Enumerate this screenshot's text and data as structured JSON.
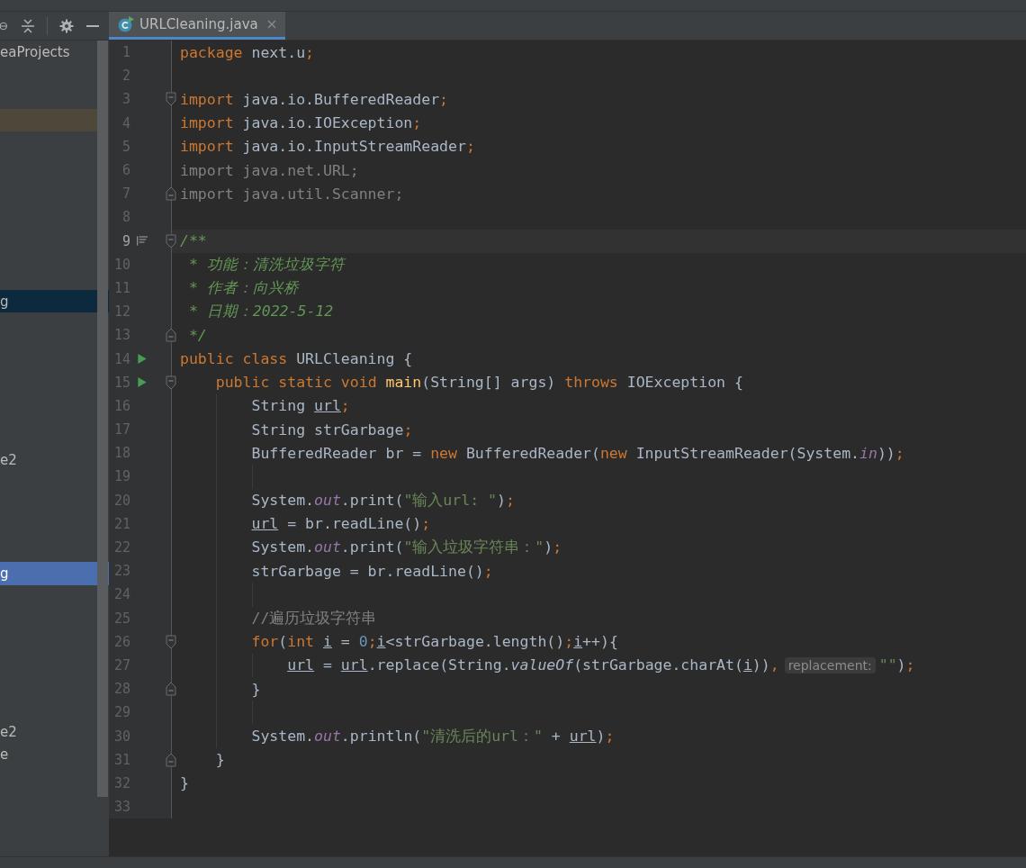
{
  "sidebar": {
    "rows": [
      {
        "label": "eaProjects",
        "selected": false
      },
      {
        "selected": false
      },
      {
        "selected": false
      },
      {
        "selected": false,
        "hovered": true
      },
      {
        "selected": false
      },
      {
        "selected": false
      },
      {
        "selected": false
      },
      {
        "selected": false
      },
      {
        "selected": false
      },
      {
        "selected": false
      },
      {
        "selected": false
      },
      {
        "label": "g",
        "selected": true,
        "focused": false
      },
      {
        "selected": false
      },
      {
        "selected": false
      },
      {
        "selected": false
      },
      {
        "selected": false
      },
      {
        "selected": false
      },
      {
        "selected": false
      },
      {
        "label": "e2",
        "selected": false
      },
      {
        "selected": false
      },
      {
        "selected": false
      },
      {
        "selected": false
      },
      {
        "selected": false
      },
      {
        "label": "g",
        "selected": true,
        "focused": true
      },
      {
        "selected": false
      },
      {
        "selected": false
      },
      {
        "selected": false
      },
      {
        "selected": false
      },
      {
        "selected": false
      },
      {
        "selected": false
      },
      {
        "label": "e2",
        "selected": false
      },
      {
        "label": "e",
        "selected": false
      }
    ]
  },
  "tabs": [
    {
      "label": "URLCleaning.java",
      "selected": true
    }
  ],
  "editor": {
    "lines": [
      {
        "n": "1",
        "tokens": [
          {
            "text": "package ",
            "kind": "kw"
          },
          {
            "text": "next.u",
            "kind": "plain"
          },
          {
            "text": ";",
            "kind": "semi"
          }
        ]
      },
      {
        "n": "2"
      },
      {
        "n": "3",
        "fold_start": true,
        "tokens": [
          {
            "text": "import ",
            "kind": "kw"
          },
          {
            "text": "java.io.BufferedReader",
            "kind": "plain"
          },
          {
            "text": ";",
            "kind": "semi"
          }
        ]
      },
      {
        "n": "4",
        "tokens": [
          {
            "text": "import ",
            "kind": "kw"
          },
          {
            "text": "java.io.IOException",
            "kind": "plain"
          },
          {
            "text": ";",
            "kind": "semi"
          }
        ]
      },
      {
        "n": "5",
        "tokens": [
          {
            "text": "import ",
            "kind": "kw"
          },
          {
            "text": "java.io.InputStreamReader",
            "kind": "plain"
          },
          {
            "text": ";",
            "kind": "semi"
          }
        ]
      },
      {
        "n": "6",
        "tokens": [
          {
            "text": "import java.net.URL;",
            "kind": "unused"
          }
        ]
      },
      {
        "n": "7",
        "fold_end": true,
        "tokens": [
          {
            "text": "import java.util.Scanner;",
            "kind": "unused"
          }
        ]
      },
      {
        "n": "8"
      },
      {
        "n": "9",
        "current": true,
        "doc_marker": true,
        "fold_start": true,
        "tokens": [
          {
            "text": "/**",
            "kind": "doc"
          }
        ]
      },
      {
        "n": "10",
        "tokens": [
          {
            "text": " * 功能：清洗垃圾字符",
            "kind": "doc"
          }
        ]
      },
      {
        "n": "11",
        "tokens": [
          {
            "text": " * 作者：向兴桥",
            "kind": "doc"
          }
        ]
      },
      {
        "n": "12",
        "tokens": [
          {
            "text": " * 日期：2022-5-12",
            "kind": "doc"
          }
        ]
      },
      {
        "n": "13",
        "fold_end": true,
        "tokens": [
          {
            "text": " */",
            "kind": "doc"
          }
        ]
      },
      {
        "n": "14",
        "run_marker": true,
        "tokens": [
          {
            "text": "public class ",
            "kind": "kw"
          },
          {
            "text": "URLCleaning {",
            "kind": "plain"
          }
        ]
      },
      {
        "n": "15",
        "run_marker": true,
        "fold_start": true,
        "tokens": [
          {
            "text": "    public static void ",
            "kind": "kw"
          },
          {
            "text": "main",
            "kind": "fn"
          },
          {
            "text": "(String[] args) ",
            "kind": "plain"
          },
          {
            "text": "throws ",
            "kind": "kw"
          },
          {
            "text": "IOException {",
            "kind": "plain"
          }
        ]
      },
      {
        "n": "16",
        "tokens": [
          {
            "text": "        String ",
            "kind": "plain"
          },
          {
            "text": "url",
            "kind": "var"
          },
          {
            "text": ";",
            "kind": "semi"
          }
        ]
      },
      {
        "n": "17",
        "tokens": [
          {
            "text": "        String strGarbage",
            "kind": "plain"
          },
          {
            "text": ";",
            "kind": "semi"
          }
        ]
      },
      {
        "n": "18",
        "tokens": [
          {
            "text": "        BufferedReader br = ",
            "kind": "plain"
          },
          {
            "text": "new ",
            "kind": "kw"
          },
          {
            "text": "BufferedReader(",
            "kind": "plain"
          },
          {
            "text": "new ",
            "kind": "kw"
          },
          {
            "text": "InputStreamReader(System.",
            "kind": "plain"
          },
          {
            "text": "in",
            "kind": "field"
          },
          {
            "text": "))",
            "kind": "plain"
          },
          {
            "text": ";",
            "kind": "semi"
          }
        ]
      },
      {
        "n": "19"
      },
      {
        "n": "20",
        "tokens": [
          {
            "text": "        System.",
            "kind": "plain"
          },
          {
            "text": "out",
            "kind": "field"
          },
          {
            "text": ".print(",
            "kind": "plain"
          },
          {
            "text": "\"输入url: \"",
            "kind": "str"
          },
          {
            "text": ")",
            "kind": "plain"
          },
          {
            "text": ";",
            "kind": "semi"
          }
        ]
      },
      {
        "n": "21",
        "tokens": [
          {
            "text": "        url",
            "kind": "var"
          },
          {
            "text": " = br.readLine()",
            "kind": "plain"
          },
          {
            "text": ";",
            "kind": "semi"
          }
        ]
      },
      {
        "n": "22",
        "tokens": [
          {
            "text": "        System.",
            "kind": "plain"
          },
          {
            "text": "out",
            "kind": "field"
          },
          {
            "text": ".print(",
            "kind": "plain"
          },
          {
            "text": "\"输入垃圾字符串：\"",
            "kind": "str"
          },
          {
            "text": ")",
            "kind": "plain"
          },
          {
            "text": ";",
            "kind": "semi"
          }
        ]
      },
      {
        "n": "23",
        "tokens": [
          {
            "text": "        strGarbage = br.readLine()",
            "kind": "plain"
          },
          {
            "text": ";",
            "kind": "semi"
          }
        ]
      },
      {
        "n": "24"
      },
      {
        "n": "25",
        "tokens": [
          {
            "text": "        //遍历垃圾字符串",
            "kind": "comment"
          }
        ]
      },
      {
        "n": "26",
        "fold_start": true,
        "tokens": [
          {
            "text": "        for",
            "kind": "kw"
          },
          {
            "text": "(",
            "kind": "plain"
          },
          {
            "text": "int ",
            "kind": "kw"
          },
          {
            "text": "i",
            "kind": "var"
          },
          {
            "text": " = ",
            "kind": "plain"
          },
          {
            "text": "0",
            "kind": "num"
          },
          {
            "text": ";",
            "kind": "semi"
          },
          {
            "text": "i",
            "kind": "var"
          },
          {
            "text": "<strGarbage.length()",
            "kind": "plain"
          },
          {
            "text": ";",
            "kind": "semi"
          },
          {
            "text": "i",
            "kind": "var"
          },
          {
            "text": "++){",
            "kind": "plain"
          }
        ]
      },
      {
        "n": "27",
        "tokens": [
          {
            "text": "            url",
            "kind": "var"
          },
          {
            "text": " = ",
            "kind": "plain"
          },
          {
            "text": "url",
            "kind": "var"
          },
          {
            "text": ".replace(String.",
            "kind": "plain"
          },
          {
            "text": "valueOf",
            "kind": "static"
          },
          {
            "text": "(strGarbage.charAt(",
            "kind": "plain"
          },
          {
            "text": "i",
            "kind": "var"
          },
          {
            "text": "))",
            "kind": "plain"
          },
          {
            "text": ",",
            "kind": "semi"
          },
          {
            "text": "replacement:",
            "kind": "hint"
          },
          {
            "text": "\"\"",
            "kind": "str"
          },
          {
            "text": ")",
            "kind": "plain"
          },
          {
            "text": ";",
            "kind": "semi"
          }
        ]
      },
      {
        "n": "28",
        "fold_end": true,
        "tokens": [
          {
            "text": "        }",
            "kind": "plain"
          }
        ]
      },
      {
        "n": "29"
      },
      {
        "n": "30",
        "tokens": [
          {
            "text": "        System.",
            "kind": "plain"
          },
          {
            "text": "out",
            "kind": "field"
          },
          {
            "text": ".println(",
            "kind": "plain"
          },
          {
            "text": "\"清洗后的url：\"",
            "kind": "str"
          },
          {
            "text": " + ",
            "kind": "plain"
          },
          {
            "text": "url",
            "kind": "var"
          },
          {
            "text": ")",
            "kind": "plain"
          },
          {
            "text": ";",
            "kind": "semi"
          }
        ]
      },
      {
        "n": "31",
        "fold_end": true,
        "tokens": [
          {
            "text": "    }",
            "kind": "plain"
          }
        ]
      },
      {
        "n": "32",
        "tokens": [
          {
            "text": "}",
            "kind": "plain"
          }
        ]
      },
      {
        "n": "33"
      }
    ]
  }
}
